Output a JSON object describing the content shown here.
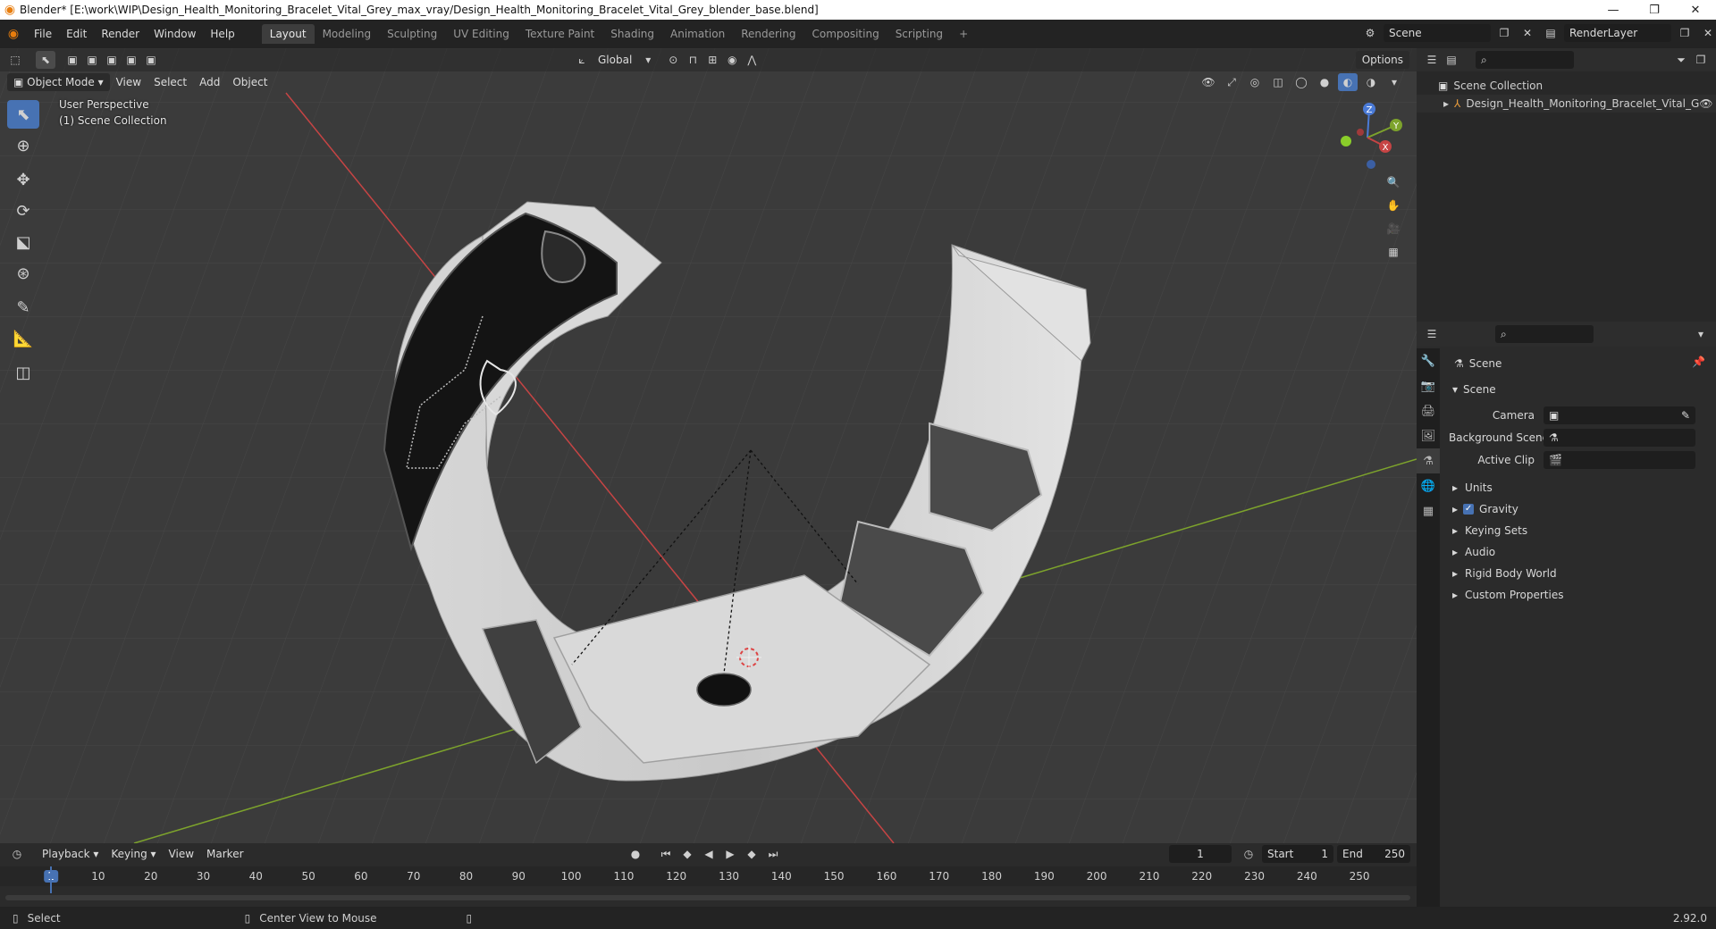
{
  "window": {
    "title": "Blender* [E:\\work\\WIP\\Design_Health_Monitoring_Bracelet_Vital_Grey_max_vray/Design_Health_Monitoring_Bracelet_Vital_Grey_blender_base.blend]",
    "minimize": "—",
    "maximize": "❐",
    "close": "✕"
  },
  "menu": [
    "File",
    "Edit",
    "Render",
    "Window",
    "Help"
  ],
  "workspaces": [
    "Layout",
    "Modeling",
    "Sculpting",
    "UV Editing",
    "Texture Paint",
    "Shading",
    "Animation",
    "Rendering",
    "Compositing",
    "Scripting"
  ],
  "workspace_add": "+",
  "scene_name": "Scene",
  "render_layer": "RenderLayer",
  "viewport": {
    "transform_orientation": "Global",
    "options_label": "Options",
    "mode": "Object Mode",
    "menus": [
      "View",
      "Select",
      "Add",
      "Object"
    ],
    "overlay_perspective": "User Perspective",
    "overlay_collection": "(1) Scene Collection",
    "gizmo_axes": {
      "z": "Z",
      "y": "Y",
      "x": "X"
    }
  },
  "outliner": {
    "root": "Scene Collection",
    "items": [
      "Design_Health_Monitoring_Bracelet_Vital_G"
    ]
  },
  "properties": {
    "header": "Scene",
    "panel_title": "Scene",
    "fields": [
      {
        "label": "Camera",
        "value": ""
      },
      {
        "label": "Background Scene",
        "value": ""
      },
      {
        "label": "Active Clip",
        "value": ""
      }
    ],
    "sections": [
      "Units",
      "Gravity",
      "Keying Sets",
      "Audio",
      "Rigid Body World",
      "Custom Properties"
    ],
    "gravity_checked": true
  },
  "timeline": {
    "menus": [
      "Playback",
      "Keying",
      "View",
      "Marker"
    ],
    "current_frame": "1",
    "start_label": "Start",
    "start_value": "1",
    "end_label": "End",
    "end_value": "250",
    "ruler": [
      "1",
      "10",
      "20",
      "30",
      "40",
      "50",
      "60",
      "70",
      "80",
      "90",
      "100",
      "110",
      "120",
      "130",
      "140",
      "150",
      "160",
      "170",
      "180",
      "190",
      "200",
      "210",
      "220",
      "230",
      "240",
      "250"
    ]
  },
  "status": {
    "left": "Select",
    "middle": "Center View to Mouse",
    "version": "2.92.0"
  },
  "colors": {
    "accent": "#4772b3",
    "axis_x": "#c64444",
    "axis_y": "#7da32c",
    "blender_orange": "#e87d0d"
  }
}
